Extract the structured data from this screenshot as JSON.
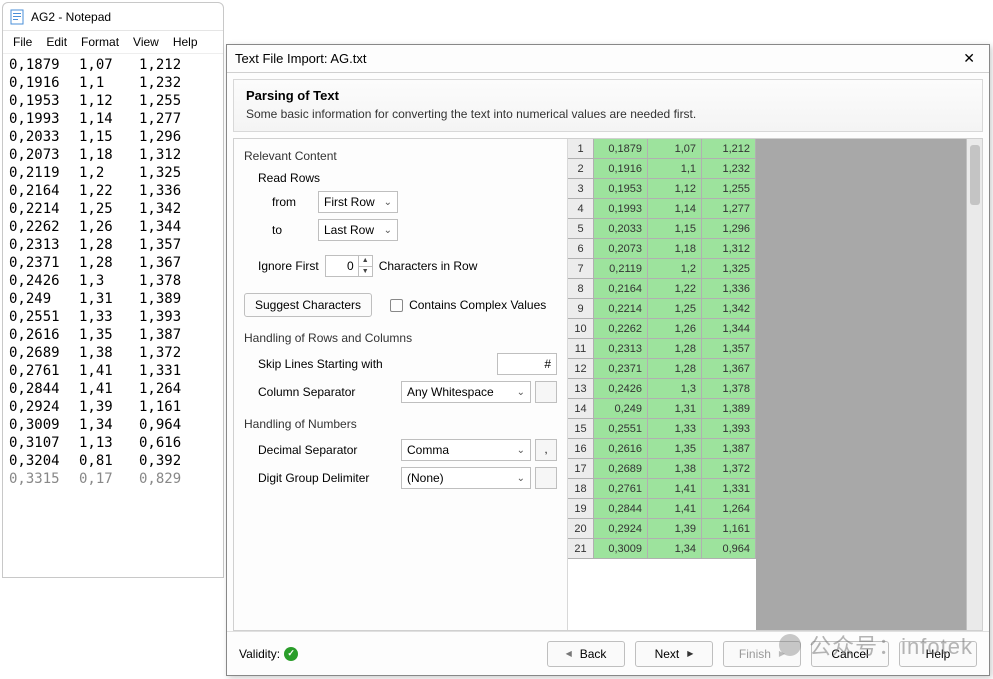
{
  "notepad": {
    "title": "AG2 - Notepad",
    "menu": [
      "File",
      "Edit",
      "Format",
      "View",
      "Help"
    ],
    "rows": [
      [
        "0,1879",
        "1,07",
        "1,212"
      ],
      [
        "0,1916",
        "1,1",
        "1,232"
      ],
      [
        "0,1953",
        "1,12",
        "1,255"
      ],
      [
        "0,1993",
        "1,14",
        "1,277"
      ],
      [
        "0,2033",
        "1,15",
        "1,296"
      ],
      [
        "0,2073",
        "1,18",
        "1,312"
      ],
      [
        "0,2119",
        "1,2",
        "1,325"
      ],
      [
        "0,2164",
        "1,22",
        "1,336"
      ],
      [
        "0,2214",
        "1,25",
        "1,342"
      ],
      [
        "0,2262",
        "1,26",
        "1,344"
      ],
      [
        "0,2313",
        "1,28",
        "1,357"
      ],
      [
        "0,2371",
        "1,28",
        "1,367"
      ],
      [
        "0,2426",
        "1,3",
        "1,378"
      ],
      [
        "0,249",
        "1,31",
        "1,389"
      ],
      [
        "0,2551",
        "1,33",
        "1,393"
      ],
      [
        "0,2616",
        "1,35",
        "1,387"
      ],
      [
        "0,2689",
        "1,38",
        "1,372"
      ],
      [
        "0,2761",
        "1,41",
        "1,331"
      ],
      [
        "0,2844",
        "1,41",
        "1,264"
      ],
      [
        "0,2924",
        "1,39",
        "1,161"
      ],
      [
        "0,3009",
        "1,34",
        "0,964"
      ],
      [
        "0,3107",
        "1,13",
        "0,616"
      ],
      [
        "0,3204",
        "0,81",
        "0,392"
      ],
      [
        "0,3315",
        "0,17",
        "0,829"
      ]
    ],
    "faded_last": true
  },
  "dialog": {
    "title": "Text File Import: AG.txt",
    "header": {
      "heading": "Parsing of Text",
      "sub": "Some basic information for converting the text into numerical values are needed first."
    },
    "left": {
      "relevant_content": "Relevant Content",
      "read_rows": "Read Rows",
      "from_lbl": "from",
      "from_val": "First Row",
      "to_lbl": "to",
      "to_val": "Last Row",
      "ignore_first_lbl": "Ignore First",
      "ignore_first_val": "0",
      "ignore_first_tail": "Characters in Row",
      "suggest_btn": "Suggest Characters",
      "complex_lbl": "Contains Complex Values",
      "rows_cols": "Handling of Rows and Columns",
      "skip_lbl": "Skip Lines Starting with",
      "skip_val": "#",
      "colsep_lbl": "Column Separator",
      "colsep_val": "Any Whitespace",
      "numbers": "Handling of Numbers",
      "dec_lbl": "Decimal Separator",
      "dec_val": "Comma",
      "dec_sq": ",",
      "grp_lbl": "Digit Group Delimiter",
      "grp_val": "(None)",
      "grp_sq": ""
    },
    "grid_rows": [
      [
        "1",
        "0,1879",
        "1,07",
        "1,212"
      ],
      [
        "2",
        "0,1916",
        "1,1",
        "1,232"
      ],
      [
        "3",
        "0,1953",
        "1,12",
        "1,255"
      ],
      [
        "4",
        "0,1993",
        "1,14",
        "1,277"
      ],
      [
        "5",
        "0,2033",
        "1,15",
        "1,296"
      ],
      [
        "6",
        "0,2073",
        "1,18",
        "1,312"
      ],
      [
        "7",
        "0,2119",
        "1,2",
        "1,325"
      ],
      [
        "8",
        "0,2164",
        "1,22",
        "1,336"
      ],
      [
        "9",
        "0,2214",
        "1,25",
        "1,342"
      ],
      [
        "10",
        "0,2262",
        "1,26",
        "1,344"
      ],
      [
        "11",
        "0,2313",
        "1,28",
        "1,357"
      ],
      [
        "12",
        "0,2371",
        "1,28",
        "1,367"
      ],
      [
        "13",
        "0,2426",
        "1,3",
        "1,378"
      ],
      [
        "14",
        "0,249",
        "1,31",
        "1,389"
      ],
      [
        "15",
        "0,2551",
        "1,33",
        "1,393"
      ],
      [
        "16",
        "0,2616",
        "1,35",
        "1,387"
      ],
      [
        "17",
        "0,2689",
        "1,38",
        "1,372"
      ],
      [
        "18",
        "0,2761",
        "1,41",
        "1,331"
      ],
      [
        "19",
        "0,2844",
        "1,41",
        "1,264"
      ],
      [
        "20",
        "0,2924",
        "1,39",
        "1,161"
      ],
      [
        "21",
        "0,3009",
        "1,34",
        "0,964"
      ]
    ],
    "footer": {
      "validity": "Validity:",
      "back": "Back",
      "next": "Next",
      "finish": "Finish",
      "cancel": "Cancel",
      "help": "Help"
    }
  },
  "watermark": "公众号：infotek"
}
